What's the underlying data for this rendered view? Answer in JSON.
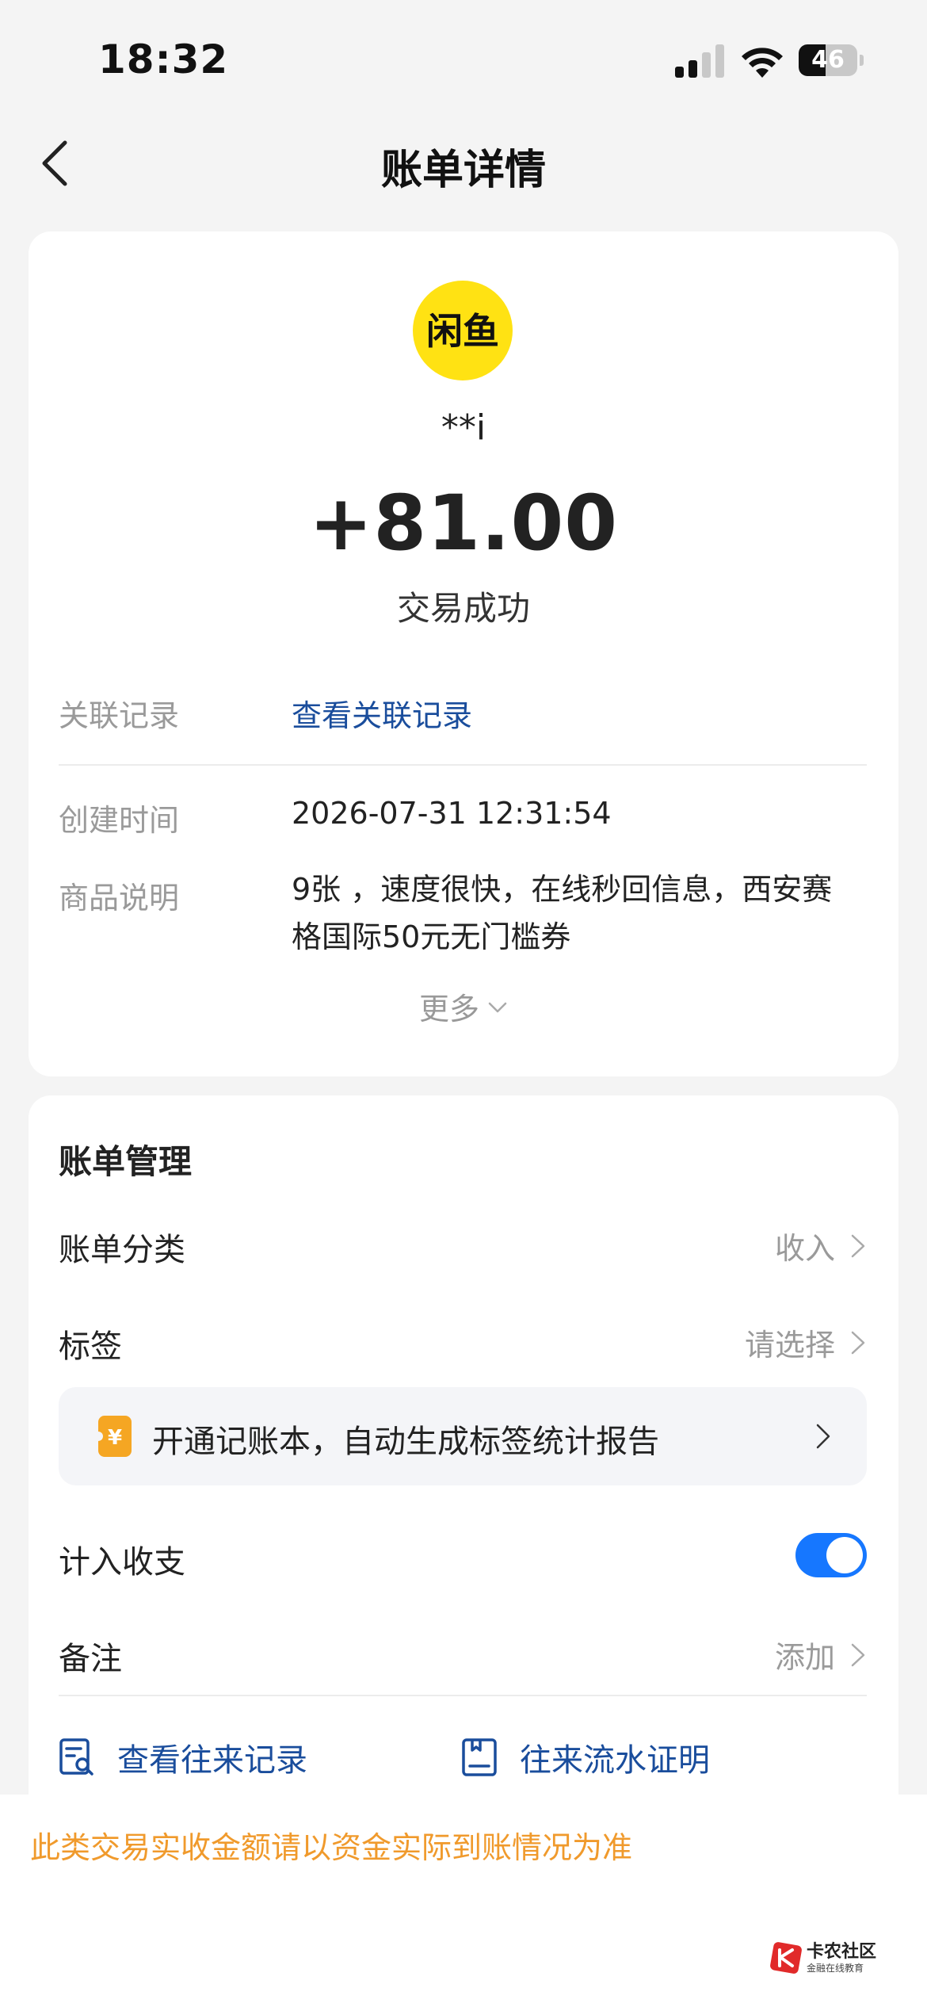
{
  "status_bar": {
    "time": "18:32",
    "battery": "46",
    "battery_level": 0.46
  },
  "nav": {
    "title": "账单详情"
  },
  "transaction": {
    "merchant_logo_text": "闲鱼",
    "payer_name": "**i",
    "amount": "+81.00",
    "status": "交易成功"
  },
  "details": {
    "related_label": "关联记录",
    "related_link": "查看关联记录",
    "created_label": "创建时间",
    "created_value": "2026-07-31 12:31:54",
    "desc_label": "商品说明",
    "desc_value": "9张 ，速度很快，在线秒回信息，西安赛格国际50元无门槛券",
    "more_label": "更多"
  },
  "management": {
    "title": "账单管理",
    "category_label": "账单分类",
    "category_value": "收入",
    "tag_label": "标签",
    "tag_value": "请选择",
    "promo_text": "开通记账本，自动生成标签统计报告",
    "include_label": "计入收支",
    "include_enabled": true,
    "note_label": "备注",
    "note_value": "添加",
    "action_history": "查看往来记录",
    "action_proof": "往来流水证明"
  },
  "footer": {
    "notice": "此类交易实收金额请以资金实际到账情况为准",
    "watermark_title": "卡农社区",
    "watermark_sub": "金融在线教育"
  },
  "colors": {
    "accent_blue": "#1677ff",
    "link_blue": "#1a4d9c",
    "warning_orange": "#f09a2c",
    "merchant_yellow": "#ffe213"
  }
}
